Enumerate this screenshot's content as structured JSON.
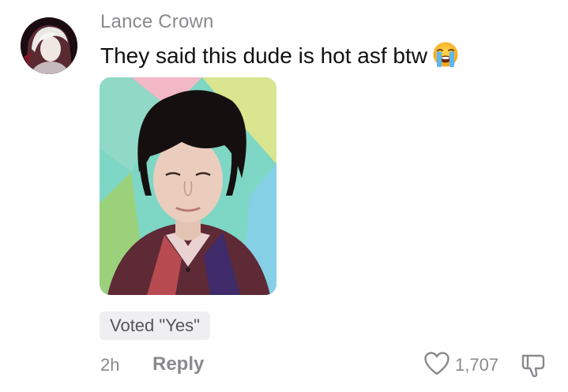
{
  "comment": {
    "username": "Lance Crown",
    "text": "They said this dude is hot asf btw",
    "emoji": "loudly-crying-face",
    "vote_badge": "Voted \"Yes\"",
    "time_ago": "2h",
    "reply_label": "Reply",
    "like_count": "1,707"
  },
  "icons": {
    "like": "heart-outline-icon",
    "dislike": "thumbs-down-outline-icon"
  },
  "colors": {
    "username": "#8a8a8e",
    "text": "#111111",
    "badge_bg": "#efeff1",
    "meta": "#8a8a8e"
  }
}
